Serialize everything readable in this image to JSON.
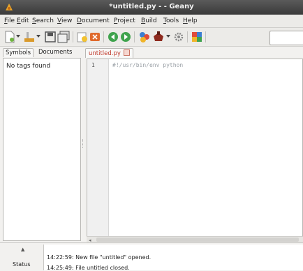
{
  "window": {
    "title": "*untitled.py - - Geany"
  },
  "menu": [
    {
      "label": "File"
    },
    {
      "label": "Edit"
    },
    {
      "label": "Search"
    },
    {
      "label": "View"
    },
    {
      "label": "Document"
    },
    {
      "label": "Project"
    },
    {
      "label": "Build"
    },
    {
      "label": "Tools"
    },
    {
      "label": "Help"
    }
  ],
  "toolbar": {
    "icons": [
      "new-icon",
      "new-dropdown-icon",
      "open-icon",
      "open-dropdown-icon",
      "save-icon",
      "save-all-icon",
      "revert-icon",
      "close-icon",
      "back-icon",
      "forward-icon",
      "compile-icon",
      "build-icon",
      "build-dropdown-icon",
      "execute-icon",
      "color-chooser-icon"
    ],
    "search_value": ""
  },
  "sidebar": {
    "tabs": [
      {
        "label": "Symbols",
        "active": true
      },
      {
        "label": "Documents",
        "active": false
      }
    ],
    "empty_message": "No tags found"
  },
  "editor": {
    "tab_label": "untitled.py",
    "lines": [
      {
        "number": "1",
        "text": "#!/usr/bin/env python"
      }
    ]
  },
  "status": {
    "tab_label": "Status",
    "messages": [
      "14:22:59: New file \"untitled\" opened.",
      "14:25:49: File untitled closed."
    ]
  },
  "colors": {
    "title_bar": "#4a4a4a",
    "tab_label_modified": "#c0392b",
    "comment_text": "#9aa0a6"
  }
}
